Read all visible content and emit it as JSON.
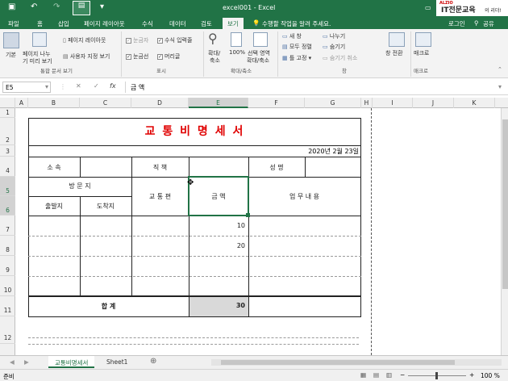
{
  "titlebar": {
    "title": "excel001 - Excel",
    "save_icon": "save-icon",
    "undo_icon": "undo-icon",
    "redo_icon": "redo-icon",
    "brand_small": "ALZIO",
    "brand_main": "IT전문교육",
    "brand_suffix": "의 리더!"
  },
  "ribbon_tabs": [
    "파일",
    "홈",
    "삽입",
    "페이지 레이아웃",
    "수식",
    "데이터",
    "검토",
    "보기"
  ],
  "tell_me": "수행할 작업을 알려 주세요.",
  "login": "로그인",
  "share": "공유",
  "ribbon": {
    "view_normal": "기본",
    "view_pagebreak_line1": "페이지 나누",
    "view_pagebreak_line2": "기 미리 보기",
    "view_pagelayout": "페이지 레이아웃",
    "view_custom": "사용자 지정 보기",
    "group_views": "통합 문서 보기",
    "ruler": "눈금자",
    "formulabar": "수식 입력줄",
    "gridlines": "눈금선",
    "headings": "머리글",
    "group_show": "표시",
    "zoom_line1": "확대/",
    "zoom_line2": "축소",
    "zoom100": "100%",
    "zoom_sel_line1": "선택 영역",
    "zoom_sel_line2": "확대/축소",
    "group_zoom": "확대/축소",
    "new_window": "새 창",
    "arrange_all": "모두 정렬",
    "freeze": "틀 고정",
    "split": "나누기",
    "hide": "숨기기",
    "unhide": "숨기기 취소",
    "switch_windows": "창 전환",
    "group_window": "창",
    "macros": "매크로",
    "group_macros": "매크로"
  },
  "formula_bar": {
    "name_box": "E5",
    "content": "금   액"
  },
  "columns": [
    "A",
    "B",
    "C",
    "D",
    "E",
    "F",
    "G",
    "H",
    "I",
    "J",
    "K"
  ],
  "rows": [
    "1",
    "2",
    "3",
    "4",
    "5",
    "6",
    "7",
    "8",
    "9",
    "10",
    "11",
    "12"
  ],
  "sheet": {
    "title": "교 통 비 명 세 서",
    "date": "2020년 2월 23일",
    "dept_label": "소   속",
    "position_label": "직   책",
    "name_label": "성   명",
    "visit_label": "방 문 지",
    "departure_label": "출발지",
    "arrival_label": "도착지",
    "transport_label": "교 통 편",
    "amount_label": "금   액",
    "work_label": "업 무 내 용",
    "row7_amount": "10",
    "row8_amount": "20",
    "total_label": "합          계",
    "total_value": "30"
  },
  "sheet_tabs": [
    "교통비명세서",
    "Sheet1"
  ],
  "status": {
    "mode": "준비",
    "zoom": "100 %"
  }
}
